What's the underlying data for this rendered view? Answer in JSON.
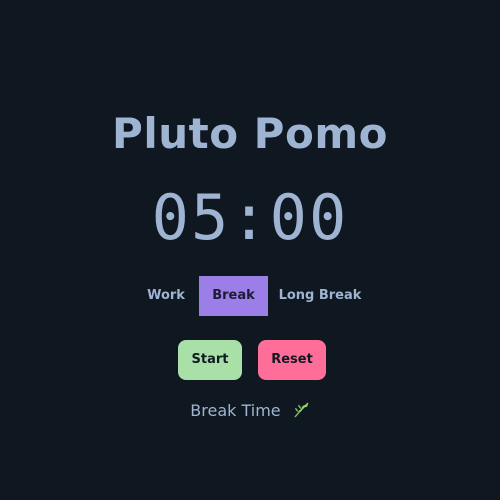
{
  "app": {
    "title": "Pluto Pomo"
  },
  "timer": {
    "display": "05:00"
  },
  "modes": {
    "items": [
      {
        "label": "Work",
        "active": false
      },
      {
        "label": "Break",
        "active": true
      },
      {
        "label": "Long Break",
        "active": false
      }
    ]
  },
  "controls": {
    "start_label": "Start",
    "reset_label": "Reset"
  },
  "status": {
    "text": "Break Time",
    "icon": "herb-leaf-icon"
  },
  "colors": {
    "background": "#0f1720",
    "text": "#9fb4d2",
    "active_mode": "#9b7fe6",
    "start_button": "#a8e0a8",
    "reset_button": "#ff6e98"
  }
}
